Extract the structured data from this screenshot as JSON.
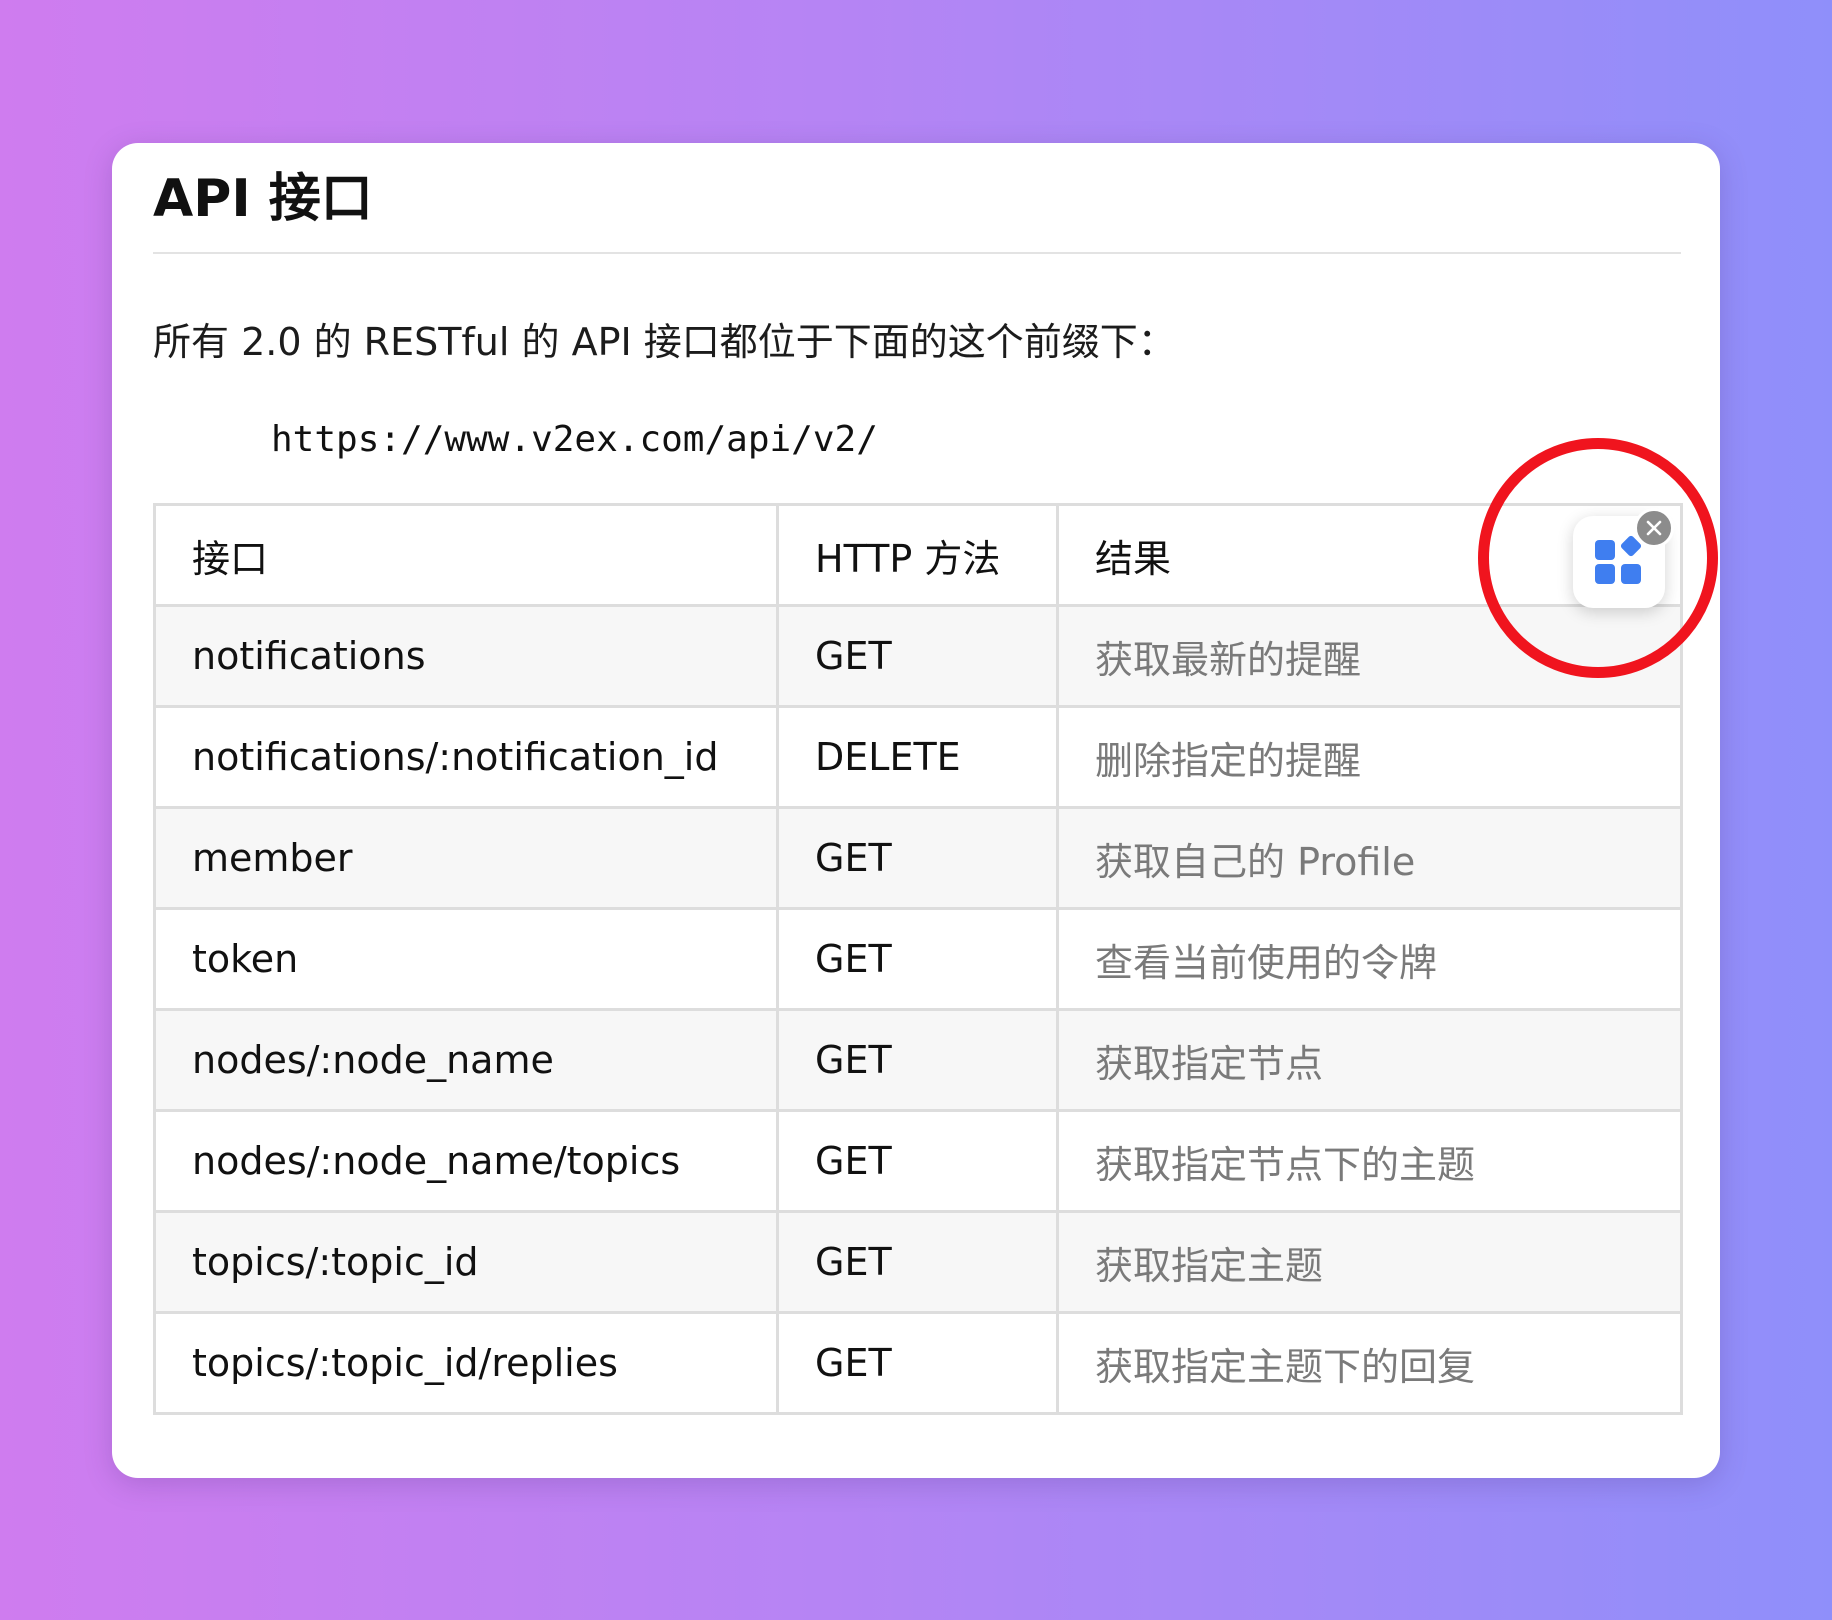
{
  "card": {
    "title": "API 接口",
    "intro": "所有 2.0 的 RESTful 的 API 接口都位于下面的这个前缀下：",
    "url": "https://www.v2ex.com/api/v2/"
  },
  "table": {
    "headers": [
      "接口",
      "HTTP 方法",
      "结果"
    ],
    "rows": [
      {
        "endpoint": "notifications",
        "method": "GET",
        "result": "获取最新的提醒"
      },
      {
        "endpoint": "notifications/:notification_id",
        "method": "DELETE",
        "result": "删除指定的提醒"
      },
      {
        "endpoint": "member",
        "method": "GET",
        "result": "获取自己的 Profile"
      },
      {
        "endpoint": "token",
        "method": "GET",
        "result": "查看当前使用的令牌"
      },
      {
        "endpoint": "nodes/:node_name",
        "method": "GET",
        "result": "获取指定节点"
      },
      {
        "endpoint": "nodes/:node_name/topics",
        "method": "GET",
        "result": "获取指定节点下的主题"
      },
      {
        "endpoint": "topics/:topic_id",
        "method": "GET",
        "result": "获取指定主题"
      },
      {
        "endpoint": "topics/:topic_id/replies",
        "method": "GET",
        "result": "获取指定主题下的回复"
      }
    ]
  },
  "widget": {
    "icon": "apps-grid-icon",
    "close_icon": "close-icon",
    "accent_color": "#3f7ef0",
    "highlight_color": "#f0141e"
  }
}
